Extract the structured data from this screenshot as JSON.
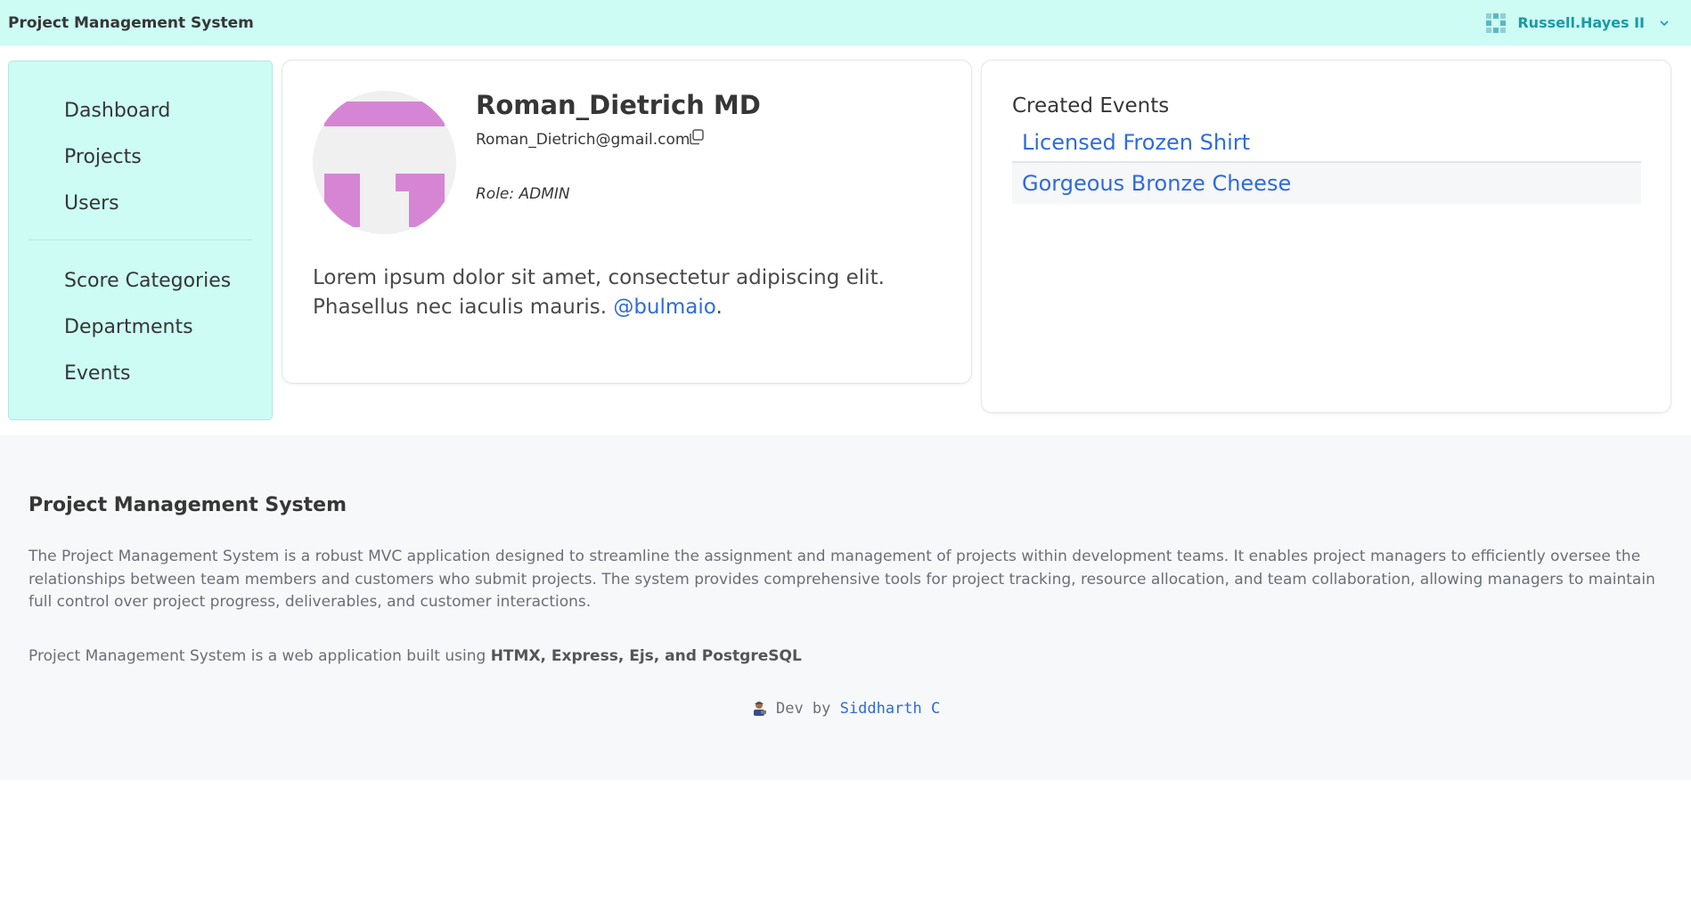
{
  "navbar": {
    "brand": "Project Management System",
    "user_name": "Russell.Hayes II"
  },
  "sidebar": {
    "items_top": [
      {
        "label": "Dashboard"
      },
      {
        "label": "Projects"
      },
      {
        "label": "Users"
      }
    ],
    "items_bottom": [
      {
        "label": "Score Categories"
      },
      {
        "label": "Departments"
      },
      {
        "label": "Events"
      }
    ]
  },
  "profile": {
    "name": "Roman_Dietrich MD",
    "email": "Roman_Dietrich@gmail.com",
    "role": "Role: ADMIN",
    "bio_text": "Lorem ipsum dolor sit amet, consectetur adipiscing elit. Phasellus nec iaculis mauris. ",
    "bio_link": "@bulmaio",
    "bio_end": ".",
    "avatar_color": "#d685d4"
  },
  "events": {
    "title": "Created Events",
    "items": [
      {
        "label": "Licensed Frozen Shirt"
      },
      {
        "label": "Gorgeous Bronze Cheese"
      }
    ]
  },
  "footer": {
    "title": "Project Management System",
    "description": "The Project Management System is a robust MVC application designed to streamline the assignment and management of projects within development teams. It enables project managers to efficiently oversee the relationships between team members and customers who submit projects. The system provides comprehensive tools for project tracking, resource allocation, and team collaboration, allowing managers to maintain full control over project progress, deliverables, and customer interactions.",
    "built_prefix": "Project Management System is a web application built using ",
    "built_tech": "HTMX, Express, Ejs, and PostgreSQL",
    "dev_prefix": " Dev by ",
    "dev_name": "Siddharth C"
  },
  "colors": {
    "navbar_bg": "#ccfcf4",
    "accent_teal": "#1a9aa6",
    "link_blue": "#2f6bdc"
  }
}
